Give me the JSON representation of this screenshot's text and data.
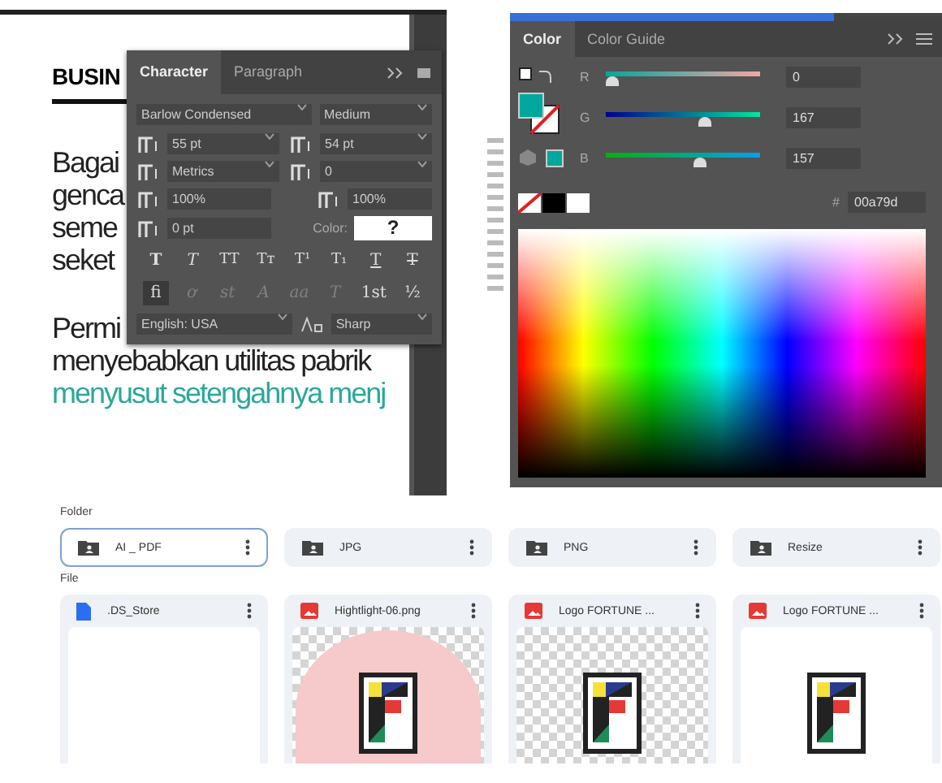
{
  "document": {
    "heading": "BUSIN",
    "lines_left": [
      "Bagai",
      "genca",
      "seme",
      "seket"
    ],
    "paragraph2_first": "Permi",
    "paragraph2_lines": [
      "menyebabkan utilitas pabrik"
    ],
    "highlight_line": "menyusut setengahnya menj"
  },
  "character_panel": {
    "tabs": [
      {
        "label": "Character",
        "selected": true
      },
      {
        "label": "Paragraph",
        "selected": false
      }
    ],
    "font_family": "Barlow Condensed",
    "font_style": "Medium",
    "fields": [
      {
        "kind": "size",
        "value": "55 pt",
        "dropdown": true
      },
      {
        "kind": "leading",
        "value": "54 pt",
        "dropdown": true
      },
      {
        "kind": "kerning",
        "value": "Metrics",
        "dropdown": true
      },
      {
        "kind": "tracking",
        "value": "0",
        "dropdown": true
      },
      {
        "kind": "vscale",
        "value": "100%",
        "dropdown": false
      },
      {
        "kind": "hscale",
        "value": "100%",
        "dropdown": false
      },
      {
        "kind": "baseline",
        "value": "0 pt",
        "dropdown": false
      }
    ],
    "color_label": "Color:",
    "color_value": "?",
    "style_buttons": [
      {
        "glyph": "T",
        "kind": "bold"
      },
      {
        "glyph": "T",
        "kind": "italic"
      },
      {
        "glyph": "TT",
        "kind": "caps"
      },
      {
        "glyph": "Tт",
        "kind": "smallcaps"
      },
      {
        "glyph": "T¹",
        "kind": "super"
      },
      {
        "glyph": "T₁",
        "kind": "sub"
      },
      {
        "glyph": "T",
        "kind": "underline"
      },
      {
        "glyph": "T",
        "kind": "strike"
      }
    ],
    "opentype_buttons": [
      {
        "glyph": "fi",
        "enabled": true,
        "selected": true
      },
      {
        "glyph": "ơ",
        "enabled": false,
        "selected": false
      },
      {
        "glyph": "st",
        "enabled": false,
        "selected": false
      },
      {
        "glyph": "A",
        "enabled": false,
        "selected": false
      },
      {
        "glyph": "aa",
        "enabled": false,
        "selected": false
      },
      {
        "glyph": "T",
        "enabled": false,
        "selected": false
      },
      {
        "glyph": "1st",
        "enabled": true,
        "selected": false
      },
      {
        "glyph": "½",
        "enabled": true,
        "selected": false
      }
    ],
    "language": "English: USA",
    "antialias": "Sharp"
  },
  "color_panel": {
    "tabs": [
      {
        "label": "Color",
        "selected": true
      },
      {
        "label": "Color Guide",
        "selected": false
      }
    ],
    "sliders": [
      {
        "label": "R",
        "value": "0",
        "level": 0,
        "kind": "red"
      },
      {
        "label": "G",
        "value": "167",
        "level": 0.655,
        "kind": "green"
      },
      {
        "label": "B",
        "value": "157",
        "level": 0.616,
        "kind": "blue"
      }
    ],
    "hex_label": "#",
    "hex": "00a79d"
  },
  "file_browser": {
    "folder_heading": "Folder",
    "folders": [
      {
        "name": "AI _ PDF",
        "selected": true
      },
      {
        "name": "JPG",
        "selected": false
      },
      {
        "name": "PNG",
        "selected": false
      },
      {
        "name": "Resize",
        "selected": false
      }
    ],
    "file_heading": "File",
    "files": [
      {
        "name": ".DS_Store",
        "kind": "document",
        "logo": false,
        "circle": false,
        "transparent": false
      },
      {
        "name": "Hightlight-06.png",
        "kind": "image",
        "logo": true,
        "circle": true,
        "transparent": true
      },
      {
        "name": "Logo FORTUNE ...",
        "kind": "image",
        "logo": true,
        "circle": false,
        "transparent": true
      },
      {
        "name": "Logo FORTUNE ...",
        "kind": "image",
        "logo": true,
        "circle": false,
        "transparent": false
      }
    ]
  }
}
